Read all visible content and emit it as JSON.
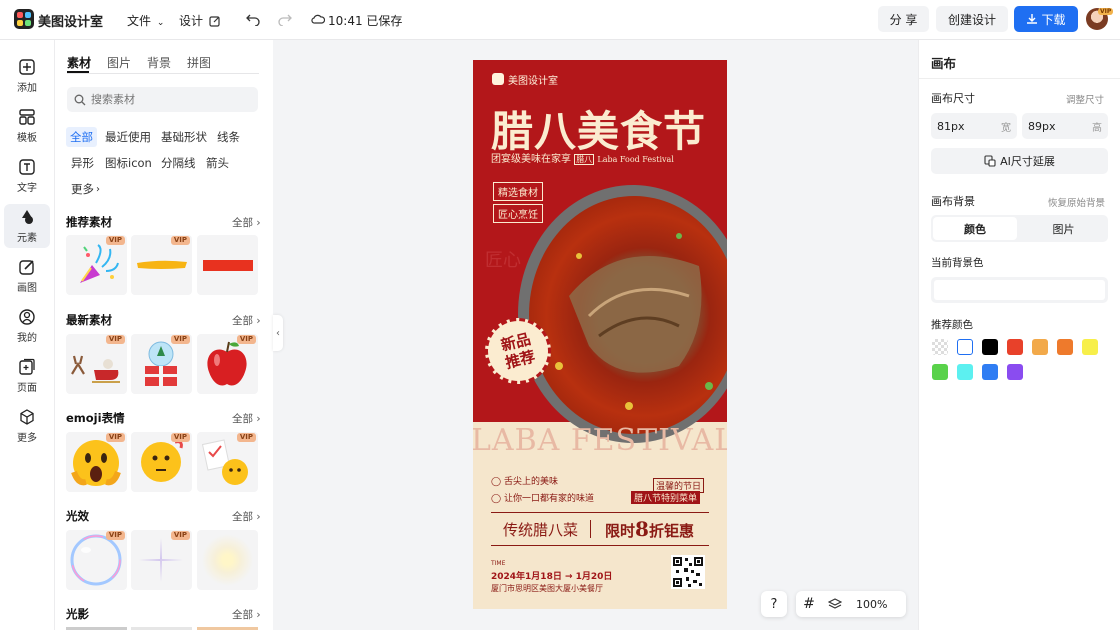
{
  "topbar": {
    "app_name": "美图设计室",
    "menu_file": "文件",
    "menu_design": "设计",
    "save_status": "10:41 已保存",
    "share_label": "分 享",
    "create_label": "创建设计",
    "download_label": "下载",
    "avatar_badge": "VIP"
  },
  "rail": {
    "items": [
      {
        "label": "添加",
        "icon": "plus-square-icon"
      },
      {
        "label": "模板",
        "icon": "template-icon"
      },
      {
        "label": "文字",
        "icon": "text-icon"
      },
      {
        "label": "元素",
        "icon": "shapes-icon"
      },
      {
        "label": "画图",
        "icon": "draw-icon"
      },
      {
        "label": "我的",
        "icon": "user-icon"
      },
      {
        "label": "页面",
        "icon": "page-add-icon"
      },
      {
        "label": "更多",
        "icon": "cube-icon"
      }
    ]
  },
  "panel": {
    "tabs": [
      "素材",
      "图片",
      "背景",
      "拼图"
    ],
    "search_placeholder": "搜索素材",
    "chips": [
      "全部",
      "最近使用",
      "基础形状",
      "线条",
      "异形",
      "图标icon",
      "分隔线",
      "箭头",
      "更多"
    ],
    "sections": [
      {
        "title": "推荐素材",
        "all": "全部"
      },
      {
        "title": "最新素材",
        "all": "全部"
      },
      {
        "title": "emoji表情",
        "all": "全部"
      },
      {
        "title": "光效",
        "all": "全部"
      },
      {
        "title": "光影",
        "all": "全部"
      }
    ],
    "vip": "VIP"
  },
  "poster": {
    "brand": "美图设计室",
    "title": "腊八美食节",
    "subtitle": "团宴级美味在家享",
    "subtitle_tag": "腊八",
    "subtitle_en": "Laba Food Festival",
    "tag1": "精选食材",
    "tag2": "匠心烹饪",
    "ghost_text": "匠心",
    "badge": "新品\n推荐",
    "banner_en": "LABA FESTIVAL",
    "bullet1": "舌尖上的美味",
    "bullet2": "让你一口都有家的味道",
    "side1": "温馨的节日",
    "side2": "腊八节特别菜单",
    "promo_left": "传统腊八菜",
    "promo_right_a": "限时",
    "promo_right_num": "8",
    "promo_right_b": "折钜惠",
    "time_label": "TIME",
    "date_range": "2024年1月18日 → 1月20日",
    "address": "厦门市思明区美图大厦小美餐厅"
  },
  "zoom": {
    "help": "?",
    "level": "100%"
  },
  "rpanel": {
    "title": "画布",
    "size_label": "画布尺寸",
    "size_adjust": "调整尺寸",
    "width_value": "81px",
    "width_unit": "宽",
    "height_value": "89px",
    "height_unit": "高",
    "ai_extend": "AI尺寸延展",
    "bg_label": "画布背景",
    "bg_reset": "恢复原始背景",
    "bg_tab_color": "颜色",
    "bg_tab_image": "图片",
    "current_bg_label": "当前背景色",
    "recommended_label": "推荐颜色",
    "colors": [
      "transparent",
      "#ffffff",
      "#000000",
      "#e8412a",
      "#f2a94a",
      "#ee7a2c",
      "#f7ef4a",
      "#59d24a",
      "#5cf0f0",
      "#2f7df3",
      "#8a4cf0"
    ]
  },
  "accent": "#1f6ff2"
}
